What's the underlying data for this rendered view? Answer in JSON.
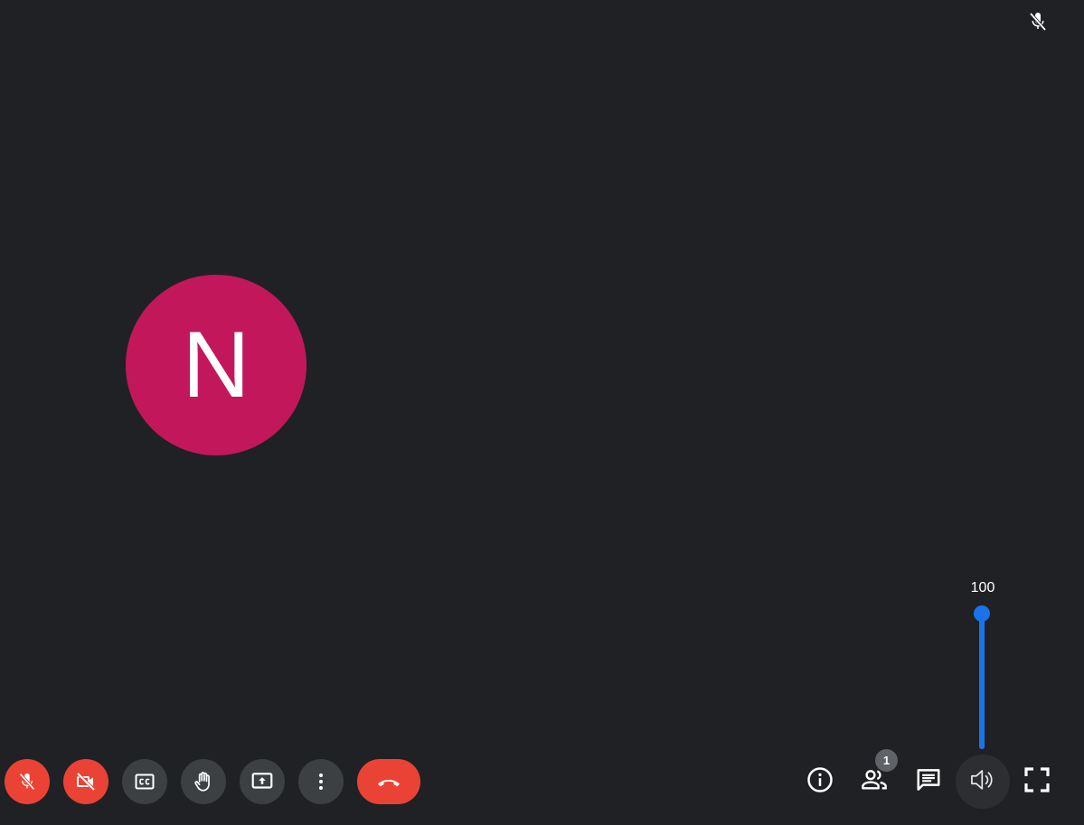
{
  "participant": {
    "initial": "N",
    "avatar_color": "#c2185b",
    "mic_status_icon": "mic-off-icon"
  },
  "toolbar": {
    "buttons": [
      {
        "name": "mic-toggle-button",
        "icon": "mic-off-icon",
        "state": "muted",
        "color": "#ea4335"
      },
      {
        "name": "camera-toggle-button",
        "icon": "video-off-icon",
        "state": "off",
        "color": "#ea4335"
      },
      {
        "name": "captions-button",
        "icon": "closed-captions-icon",
        "color": "#3c4043"
      },
      {
        "name": "raise-hand-button",
        "icon": "hand-icon",
        "color": "#3c4043"
      },
      {
        "name": "present-screen-button",
        "icon": "present-screen-icon",
        "color": "#3c4043"
      },
      {
        "name": "more-options-button",
        "icon": "more-vertical-icon",
        "color": "#3c4043"
      },
      {
        "name": "leave-call-button",
        "icon": "call-end-icon",
        "color": "#ea4335"
      }
    ]
  },
  "right_controls": {
    "info_icon": "info-icon",
    "people_icon": "people-icon",
    "participant_count": "1",
    "chat_icon": "chat-icon",
    "volume_icon": "speaker-icon",
    "fullscreen_icon": "fullscreen-icon"
  },
  "volume": {
    "value": "100",
    "level": 1.0,
    "accent": "#1a73e8"
  },
  "colors": {
    "background": "#202124",
    "danger": "#ea4335",
    "button_gray": "#3c4043"
  }
}
